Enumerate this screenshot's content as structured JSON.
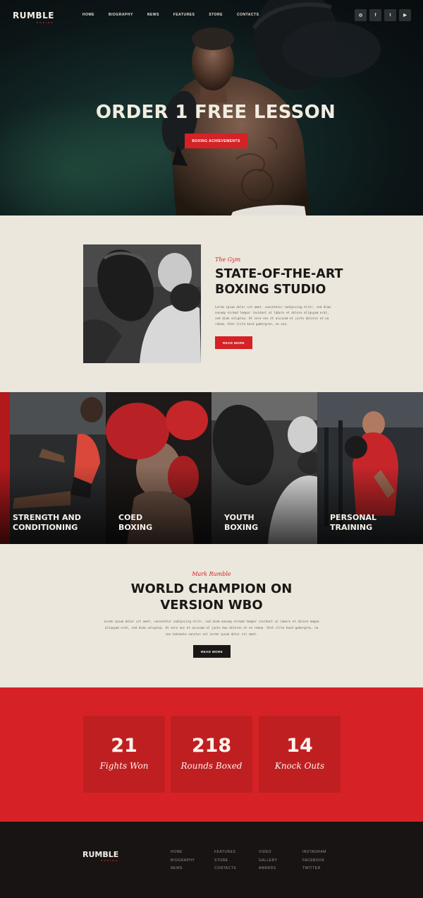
{
  "brand": {
    "name": "RUMBLE",
    "tagline": "BOXING"
  },
  "nav": {
    "items": [
      "HOME",
      "BIOGRAPHY",
      "NEWS",
      "FEATURES",
      "STORE",
      "CONTACTS"
    ]
  },
  "social": {
    "icons": [
      "instagram-icon",
      "facebook-icon",
      "twitter-icon",
      "youtube-icon"
    ],
    "glyphs": [
      "◎",
      "f",
      "t",
      "▶"
    ]
  },
  "hero": {
    "title": "ORDER 1 FREE LESSON",
    "button": "BOXING ACHIEVEMENTS"
  },
  "gym": {
    "script": "The Gym",
    "title_line1": "STATE-OF-THE-ART",
    "title_line2": "BOXING STUDIO",
    "body": "Lorem ipsum dolor sit amet, consetetur sadipscing elitr, sed diam nonumy eirmod tempor invidunt ut labore et dolore aliquyam erat, sed diam voluptua. At vero eos et accusam et justo dolores et ea rebum. Stet clita kasd gubergren, no sea.",
    "button": "READ MORE"
  },
  "services": [
    {
      "line1": "STRENGTH AND",
      "line2": "CONDITIONING"
    },
    {
      "line1": "COED",
      "line2": "BOXING"
    },
    {
      "line1": "YOUTH",
      "line2": "BOXING"
    },
    {
      "line1": "PERSONAL",
      "line2": "TRAINING"
    }
  ],
  "champion": {
    "script": "Mark Rumble",
    "title_line1": "WORLD CHAMPION ON",
    "title_line2": "VERSION WBO",
    "body": "Lorem ipsum dolor sit amet, consetetur sadipscing elitr, sed diam nonumy eirmod tempor invidunt ut labore et dolore magna aliquyam erat, sed diam voluptua. At vero eos et accusam et justo duo dolores et ea rebum. Stet clita kasd gubergren, no sea takimata sanctus est Lorem ipsum dolor sit amet.",
    "button": "READ MORE"
  },
  "stats": [
    {
      "value": "21",
      "label": "Fights Won"
    },
    {
      "value": "218",
      "label": "Rounds Boxed"
    },
    {
      "value": "14",
      "label": "Knock Outs"
    }
  ],
  "footer": {
    "columns": [
      [
        "HOME",
        "BIOGRAPHY",
        "NEWS"
      ],
      [
        "FEATURES",
        "STORE",
        "CONTACTS"
      ],
      [
        "VIDEO",
        "GALLERY",
        "AWARDS"
      ],
      [
        "INSTAGRAM",
        "FACEBOOK",
        "TWITTER"
      ]
    ]
  },
  "colors": {
    "accent": "#d42226",
    "dark": "#171413",
    "cream": "#ece7dc"
  }
}
